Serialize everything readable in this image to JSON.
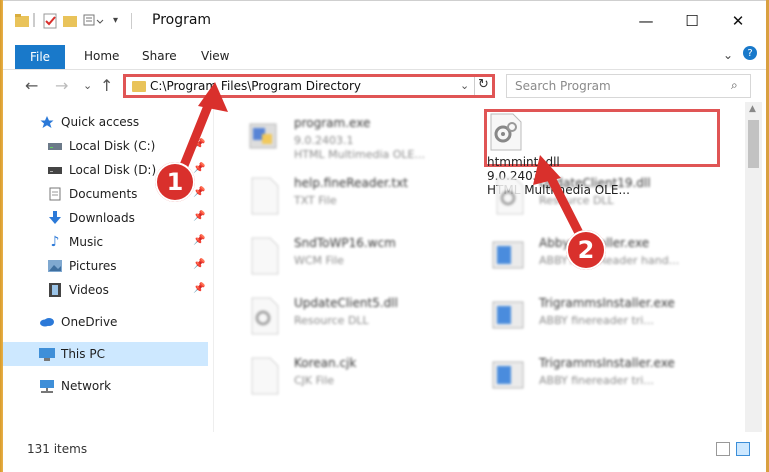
{
  "window": {
    "title": "Program",
    "minimize": "—",
    "maximize": "☐",
    "close": "✕"
  },
  "ribbon": {
    "tabs": [
      "File",
      "Home",
      "Share",
      "View"
    ],
    "collapse": "⌄",
    "help": "?"
  },
  "nav": {
    "back": "←",
    "forward": "→",
    "recent": "⌄",
    "up": "↑",
    "address": "C:\\Program Files\\Program Directory",
    "address_dropdown": "⌄",
    "refresh": "↻",
    "search_placeholder": "Search Program",
    "search_icon": "⌕"
  },
  "sidebar": {
    "items": [
      {
        "label": "Quick access",
        "icon": "star-icon",
        "pinned": false
      },
      {
        "label": "Local Disk (C:)",
        "icon": "drive-icon",
        "pinned": true
      },
      {
        "label": "Local Disk (D:)",
        "icon": "drive-icon",
        "pinned": true
      },
      {
        "label": "Documents",
        "icon": "documents-icon",
        "pinned": true
      },
      {
        "label": "Downloads",
        "icon": "download-icon",
        "pinned": true
      },
      {
        "label": "Music",
        "icon": "music-icon",
        "pinned": true
      },
      {
        "label": "Pictures",
        "icon": "pictures-icon",
        "pinned": true
      },
      {
        "label": "Videos",
        "icon": "videos-icon",
        "pinned": true
      },
      {
        "label": "OneDrive",
        "icon": "cloud-icon",
        "pinned": false
      },
      {
        "label": "This PC",
        "icon": "computer-icon",
        "pinned": false,
        "selected": true
      },
      {
        "label": "Network",
        "icon": "network-icon",
        "pinned": false
      }
    ]
  },
  "files": [
    {
      "name": "program.exe",
      "line2": "9.0.2403.1",
      "line3": "HTML Multimedia OLE...",
      "icon": "exe-icon"
    },
    {
      "name": "htmmintl.dll",
      "line2": "9.0.2403.1",
      "line3": "HTML Multimedia OLE...",
      "icon": "dll-gear-icon",
      "highlighted": true
    },
    {
      "name": "help.fineReader.txt",
      "line2": "TXT File",
      "icon": "text-file-icon"
    },
    {
      "name": "UpdateClient19.dll",
      "line2": "Resource DLL",
      "icon": "dll-gear-icon"
    },
    {
      "name": "SndToWP16.wcm",
      "line2": "WCM File",
      "icon": "blank-file-icon"
    },
    {
      "name": "AbbyyInstaller.exe",
      "line2": "ABBYY fineReader hand...",
      "icon": "installer-icon"
    },
    {
      "name": "UpdateClient5.dll",
      "line2": "Resource DLL",
      "icon": "dll-gear-icon"
    },
    {
      "name": "TrigrammsInstaller.exe",
      "line2": "ABBY finereader tri...",
      "icon": "installer-icon"
    },
    {
      "name": "Korean.cjk",
      "line2": "CJK File",
      "icon": "blank-file-icon"
    },
    {
      "name": "TrigrammsInstaller.exe",
      "line2": "ABBY finereader tri...",
      "icon": "installer-icon"
    }
  ],
  "status": {
    "item_count": "131 items"
  },
  "annotations": {
    "step1": "1",
    "step2": "2",
    "color": "#d9302c"
  }
}
